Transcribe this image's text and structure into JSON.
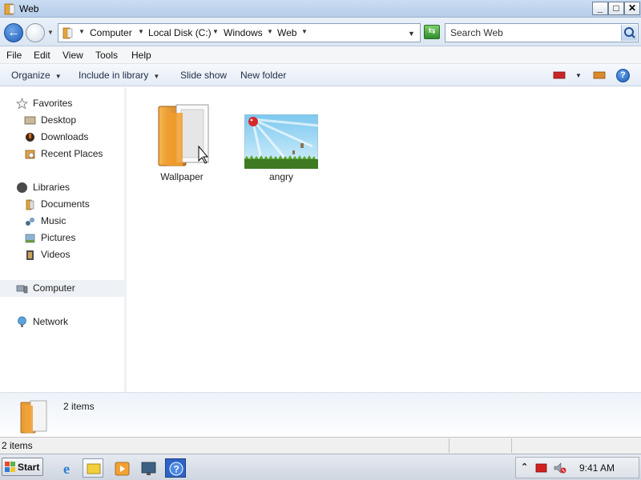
{
  "window": {
    "title": "Web",
    "buttons": {
      "minimize": "_",
      "maximize": "□",
      "close": "✕"
    }
  },
  "address_bar": {
    "breadcrumbs": [
      "Computer",
      "Local Disk (C:)",
      "Windows",
      "Web"
    ],
    "search_placeholder": "Search Web"
  },
  "menubar": [
    "File",
    "Edit",
    "View",
    "Tools",
    "Help"
  ],
  "command_bar": {
    "organize": "Organize",
    "include_in_library": "Include in library",
    "slide_show": "Slide show",
    "new_folder": "New folder",
    "help_glyph": "?"
  },
  "nav_pane": {
    "favorites": {
      "label": "Favorites",
      "items": [
        "Desktop",
        "Downloads",
        "Recent Places"
      ]
    },
    "libraries": {
      "label": "Libraries",
      "items": [
        "Documents",
        "Music",
        "Pictures",
        "Videos"
      ]
    },
    "computer": "Computer",
    "network": "Network"
  },
  "files": [
    {
      "name": "Wallpaper",
      "type": "folder"
    },
    {
      "name": "angry",
      "type": "image"
    }
  ],
  "details_pane": {
    "count": "2 items"
  },
  "status_bar": {
    "text": "2 items"
  },
  "taskbar": {
    "start": "Start",
    "pinned": [
      "ie-icon",
      "explorer-icon",
      "media-player-icon",
      "network-monitor-icon",
      "help-icon"
    ],
    "clock": "9:41 AM",
    "tray_expand_glyph": "⌃"
  },
  "colors": {
    "accent": "#1d5eb8",
    "titlebar": "#c9dcf2",
    "selected_nav": "#eef1f5"
  }
}
